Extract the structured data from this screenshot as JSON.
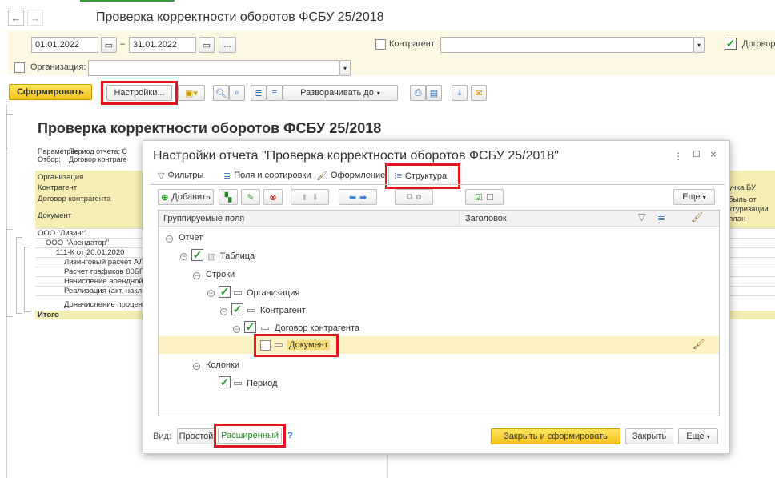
{
  "window": {
    "title": "Проверка корректности оборотов ФСБУ 25/2018",
    "back_icon": "arrow-left-icon",
    "forward_icon": "arrow-right-icon"
  },
  "filters": {
    "date_from": "01.01.2022",
    "dash": "–",
    "date_to": "31.01.2022",
    "more_btn": "...",
    "counterparty_label": "Контрагент:",
    "counterparty_value": "",
    "contract_label": "Договор",
    "organization_label": "Организация:",
    "organization_value": ""
  },
  "toolbar": {
    "generate": "Сформировать",
    "settings": "Настройки...",
    "expand_to": "Разворачивать до"
  },
  "report": {
    "title": "Проверка корректности оборотов ФСБУ 25/2018",
    "params_label": "Параметры:",
    "params_value": "Период отчета: С",
    "filter_label": "Отбор:",
    "filter_value": "Договор контраге",
    "headers": [
      "Организация",
      "Контрагент",
      "Договор контрагента",
      "Документ"
    ],
    "headers_right": [
      "учка БУ",
      "быль от",
      "ктуризации",
      "план"
    ],
    "rows": [
      "ООО \"Лизинг\"",
      "ООО \"Арендатор\"",
      "111-К от 20.01.2020",
      "Лизинговый расчет АЛ",
      "Расчет графиков 00БГ",
      "Начисление арендной",
      "Реализация (акт, накл",
      "Доначисление процен"
    ],
    "total": "Итого"
  },
  "modal": {
    "title": "Настройки отчета \"Проверка корректности оборотов ФСБУ 25/2018\"",
    "tabs": [
      "Фильтры",
      "Поля и сортировки",
      "Оформление",
      "Структура"
    ],
    "add_btn": "Добавить",
    "more_btn": "Еще",
    "col_grouped": "Группируемые поля",
    "col_header": "Заголовок",
    "tree": {
      "report": "Отчет",
      "table": "Таблица",
      "rows": "Строки",
      "organization": "Организация",
      "counterparty": "Контрагент",
      "contract": "Договор контрагента",
      "document": "Документ",
      "columns": "Колонки",
      "period": "Период"
    },
    "view_label": "Вид:",
    "view_simple": "Простой",
    "view_advanced": "Расширенный",
    "help": "?",
    "close_generate": "Закрыть и сформировать",
    "close": "Закрыть",
    "more_footer": "Еще"
  },
  "colors": {
    "accent_yellow": "#f1c21b",
    "highlight_red": "#e0151d",
    "check_green": "#2ca02c",
    "panel_yellow": "#fdf8e3"
  }
}
